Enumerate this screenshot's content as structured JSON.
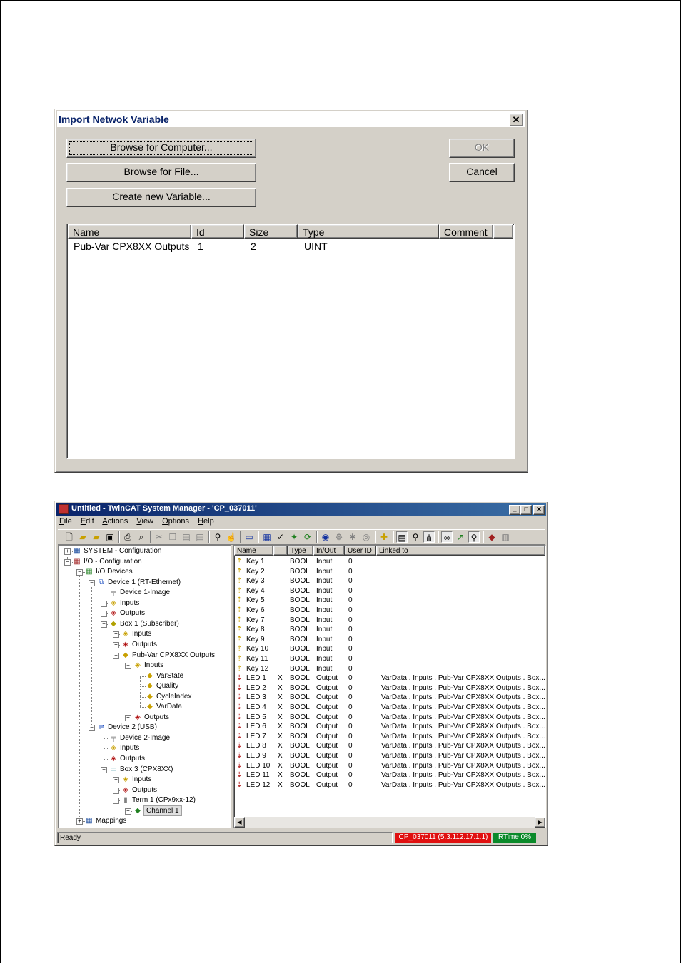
{
  "dialog": {
    "title": "Import Netwok Variable",
    "close_glyph": "✕",
    "buttons": {
      "browse_computer": "Browse for Computer...",
      "browse_file": "Browse for File...",
      "create_variable": "Create new Variable...",
      "ok": "OK",
      "cancel": "Cancel"
    },
    "columns": [
      "Name",
      "Id",
      "Size",
      "Type",
      "Comment"
    ],
    "rows": [
      {
        "name": "Pub-Var CPX8XX Outputs",
        "id": "1",
        "size": "2",
        "type": "UINT",
        "comment": ""
      }
    ]
  },
  "app": {
    "title": "Untitled - TwinCAT System Manager - 'CP_037011'",
    "menu": [
      {
        "key": "F",
        "rest": "ile"
      },
      {
        "key": "E",
        "rest": "dit"
      },
      {
        "key": "A",
        "rest": "ctions"
      },
      {
        "key": "V",
        "rest": "iew"
      },
      {
        "key": "O",
        "rest": "ptions"
      },
      {
        "key": "H",
        "rest": "elp"
      }
    ],
    "tree": [
      {
        "label": "SYSTEM - Configuration",
        "level": 0,
        "expander": "+",
        "icon": "system-icon"
      },
      {
        "label": "I/O - Configuration",
        "level": 0,
        "expander": "-",
        "icon": "io-config-icon"
      },
      {
        "label": "I/O Devices",
        "level": 1,
        "expander": "-",
        "icon": "io-devices-icon"
      },
      {
        "label": "Device 1 (RT-Ethernet)",
        "level": 2,
        "expander": "-",
        "icon": "ethernet-device-icon"
      },
      {
        "label": "Device 1-Image",
        "level": 3,
        "expander": "",
        "icon": "image-icon"
      },
      {
        "label": "Inputs",
        "level": 3,
        "expander": "+",
        "icon": "inputs-icon"
      },
      {
        "label": "Outputs",
        "level": 3,
        "expander": "+",
        "icon": "outputs-icon"
      },
      {
        "label": "Box 1 (Subscriber)",
        "level": 3,
        "expander": "-",
        "icon": "box-icon"
      },
      {
        "label": "Inputs",
        "level": 4,
        "expander": "+",
        "icon": "inputs-icon"
      },
      {
        "label": "Outputs",
        "level": 4,
        "expander": "+",
        "icon": "outputs-icon"
      },
      {
        "label": "Pub-Var CPX8XX Outputs",
        "level": 4,
        "expander": "-",
        "icon": "pubvar-icon"
      },
      {
        "label": "Inputs",
        "level": 5,
        "expander": "-",
        "icon": "inputs-icon"
      },
      {
        "label": "VarState",
        "level": 6,
        "expander": "",
        "icon": "var-input-icon"
      },
      {
        "label": "Quality",
        "level": 6,
        "expander": "",
        "icon": "var-input-icon"
      },
      {
        "label": "CycleIndex",
        "level": 6,
        "expander": "",
        "icon": "var-input-icon"
      },
      {
        "label": "VarData",
        "level": 6,
        "expander": "",
        "icon": "var-linked-icon"
      },
      {
        "label": "Outputs",
        "level": 5,
        "expander": "+",
        "icon": "outputs-icon"
      },
      {
        "label": "Device 2 (USB)",
        "level": 2,
        "expander": "-",
        "icon": "usb-device-icon"
      },
      {
        "label": "Device 2-Image",
        "level": 3,
        "expander": "",
        "icon": "image-icon"
      },
      {
        "label": "Inputs",
        "level": 3,
        "expander": "",
        "icon": "inputs-icon"
      },
      {
        "label": "Outputs",
        "level": 3,
        "expander": "",
        "icon": "outputs-icon"
      },
      {
        "label": "Box 3 (CPX8XX)",
        "level": 3,
        "expander": "-",
        "icon": "cpx-box-icon"
      },
      {
        "label": "Inputs",
        "level": 4,
        "expander": "+",
        "icon": "inputs-icon"
      },
      {
        "label": "Outputs",
        "level": 4,
        "expander": "+",
        "icon": "outputs-icon"
      },
      {
        "label": "Term 1 (CPx9xx-12)",
        "level": 4,
        "expander": "-",
        "icon": "terminal-icon"
      },
      {
        "label": "Channel 1",
        "level": 5,
        "expander": "+",
        "icon": "channel-icon",
        "selected": true
      },
      {
        "label": "Mappings",
        "level": 1,
        "expander": "+",
        "icon": "mappings-icon"
      }
    ],
    "grid_columns": [
      "Name",
      "",
      "Type",
      "In/Out",
      "User ID",
      "Linked to"
    ],
    "grid_rows": [
      {
        "name": "Key 1",
        "x": "",
        "type": "BOOL",
        "io": "Input",
        "uid": "0",
        "linked": ""
      },
      {
        "name": "Key 2",
        "x": "",
        "type": "BOOL",
        "io": "Input",
        "uid": "0",
        "linked": ""
      },
      {
        "name": "Key 3",
        "x": "",
        "type": "BOOL",
        "io": "Input",
        "uid": "0",
        "linked": ""
      },
      {
        "name": "Key 4",
        "x": "",
        "type": "BOOL",
        "io": "Input",
        "uid": "0",
        "linked": ""
      },
      {
        "name": "Key 5",
        "x": "",
        "type": "BOOL",
        "io": "Input",
        "uid": "0",
        "linked": ""
      },
      {
        "name": "Key 6",
        "x": "",
        "type": "BOOL",
        "io": "Input",
        "uid": "0",
        "linked": ""
      },
      {
        "name": "Key 7",
        "x": "",
        "type": "BOOL",
        "io": "Input",
        "uid": "0",
        "linked": ""
      },
      {
        "name": "Key 8",
        "x": "",
        "type": "BOOL",
        "io": "Input",
        "uid": "0",
        "linked": ""
      },
      {
        "name": "Key 9",
        "x": "",
        "type": "BOOL",
        "io": "Input",
        "uid": "0",
        "linked": ""
      },
      {
        "name": "Key 10",
        "x": "",
        "type": "BOOL",
        "io": "Input",
        "uid": "0",
        "linked": ""
      },
      {
        "name": "Key 11",
        "x": "",
        "type": "BOOL",
        "io": "Input",
        "uid": "0",
        "linked": ""
      },
      {
        "name": "Key 12",
        "x": "",
        "type": "BOOL",
        "io": "Input",
        "uid": "0",
        "linked": ""
      },
      {
        "name": "LED 1",
        "x": "X",
        "type": "BOOL",
        "io": "Output",
        "uid": "0",
        "linked": "VarData . Inputs . Pub-Var CPX8XX Outputs . Box..."
      },
      {
        "name": "LED 2",
        "x": "X",
        "type": "BOOL",
        "io": "Output",
        "uid": "0",
        "linked": "VarData . Inputs . Pub-Var CPX8XX Outputs . Box..."
      },
      {
        "name": "LED 3",
        "x": "X",
        "type": "BOOL",
        "io": "Output",
        "uid": "0",
        "linked": "VarData . Inputs . Pub-Var CPX8XX Outputs . Box..."
      },
      {
        "name": "LED 4",
        "x": "X",
        "type": "BOOL",
        "io": "Output",
        "uid": "0",
        "linked": "VarData . Inputs . Pub-Var CPX8XX Outputs . Box..."
      },
      {
        "name": "LED 5",
        "x": "X",
        "type": "BOOL",
        "io": "Output",
        "uid": "0",
        "linked": "VarData . Inputs . Pub-Var CPX8XX Outputs . Box..."
      },
      {
        "name": "LED 6",
        "x": "X",
        "type": "BOOL",
        "io": "Output",
        "uid": "0",
        "linked": "VarData . Inputs . Pub-Var CPX8XX Outputs . Box..."
      },
      {
        "name": "LED 7",
        "x": "X",
        "type": "BOOL",
        "io": "Output",
        "uid": "0",
        "linked": "VarData . Inputs . Pub-Var CPX8XX Outputs . Box..."
      },
      {
        "name": "LED 8",
        "x": "X",
        "type": "BOOL",
        "io": "Output",
        "uid": "0",
        "linked": "VarData . Inputs . Pub-Var CPX8XX Outputs . Box..."
      },
      {
        "name": "LED 9",
        "x": "X",
        "type": "BOOL",
        "io": "Output",
        "uid": "0",
        "linked": "VarData . Inputs . Pub-Var CPX8XX Outputs . Box..."
      },
      {
        "name": "LED 10",
        "x": "X",
        "type": "BOOL",
        "io": "Output",
        "uid": "0",
        "linked": "VarData . Inputs . Pub-Var CPX8XX Outputs . Box..."
      },
      {
        "name": "LED 11",
        "x": "X",
        "type": "BOOL",
        "io": "Output",
        "uid": "0",
        "linked": "VarData . Inputs . Pub-Var CPX8XX Outputs . Box..."
      },
      {
        "name": "LED 12",
        "x": "X",
        "type": "BOOL",
        "io": "Output",
        "uid": "0",
        "linked": "VarData . Inputs . Pub-Var CPX8XX Outputs . Box..."
      }
    ],
    "status": {
      "ready": "Ready",
      "plc": "CP_037011 (5.3.112.17.1.1)",
      "runtime": "RTime 0%",
      "plc_color": "#e01010",
      "runtime_color": "#0a8a2a"
    }
  }
}
